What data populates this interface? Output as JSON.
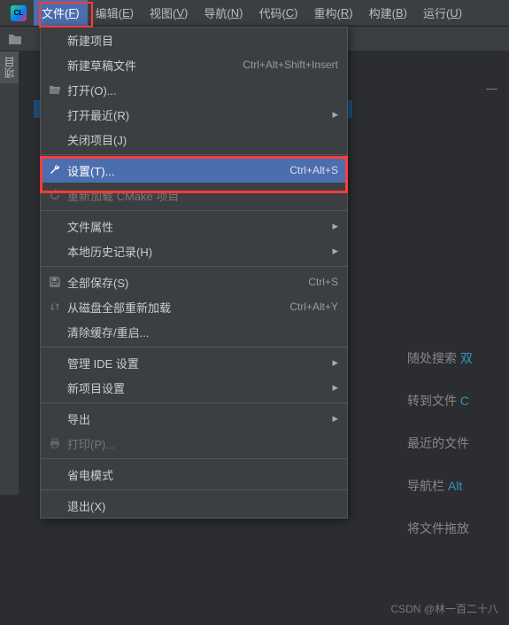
{
  "menubar": {
    "items": [
      {
        "label": "文件",
        "mnemonic": "F"
      },
      {
        "label": "编辑",
        "mnemonic": "E"
      },
      {
        "label": "视图",
        "mnemonic": "V"
      },
      {
        "label": "导航",
        "mnemonic": "N"
      },
      {
        "label": "代码",
        "mnemonic": "C"
      },
      {
        "label": "重构",
        "mnemonic": "R"
      },
      {
        "label": "构建",
        "mnemonic": "B"
      },
      {
        "label": "运行",
        "mnemonic": "U"
      }
    ],
    "active_index": 0,
    "logo_text": "CL"
  },
  "side_tab_label": "项目",
  "dropdown": {
    "items": [
      {
        "type": "item",
        "icon": "",
        "label": "新建项目",
        "shortcut": "",
        "submenu": false
      },
      {
        "type": "item",
        "icon": "",
        "label": "新建草稿文件",
        "shortcut": "Ctrl+Alt+Shift+Insert",
        "submenu": false
      },
      {
        "type": "item",
        "icon": "folder-open",
        "label": "打开(O)...",
        "shortcut": "",
        "submenu": false
      },
      {
        "type": "item",
        "icon": "",
        "label": "打开最近(R)",
        "shortcut": "",
        "submenu": true
      },
      {
        "type": "item",
        "icon": "",
        "label": "关闭项目(J)",
        "shortcut": "",
        "submenu": false
      },
      {
        "type": "sep"
      },
      {
        "type": "item",
        "icon": "wrench",
        "label": "设置(T)...",
        "shortcut": "Ctrl+Alt+S",
        "submenu": false,
        "selected": true
      },
      {
        "type": "item",
        "icon": "refresh",
        "label": "重新加载 CMake 项目",
        "shortcut": "",
        "submenu": false,
        "disabled": true
      },
      {
        "type": "sep"
      },
      {
        "type": "item",
        "icon": "",
        "label": "文件属性",
        "shortcut": "",
        "submenu": true
      },
      {
        "type": "item",
        "icon": "",
        "label": "本地历史记录(H)",
        "shortcut": "",
        "submenu": true
      },
      {
        "type": "sep"
      },
      {
        "type": "item",
        "icon": "save",
        "label": "全部保存(S)",
        "shortcut": "Ctrl+S",
        "submenu": false
      },
      {
        "type": "item",
        "icon": "reload",
        "label": "从磁盘全部重新加载",
        "shortcut": "Ctrl+Alt+Y",
        "submenu": false
      },
      {
        "type": "item",
        "icon": "",
        "label": "清除缓存/重启...",
        "shortcut": "",
        "submenu": false
      },
      {
        "type": "sep"
      },
      {
        "type": "item",
        "icon": "",
        "label": "管理 IDE 设置",
        "shortcut": "",
        "submenu": true
      },
      {
        "type": "item",
        "icon": "",
        "label": "新项目设置",
        "shortcut": "",
        "submenu": true
      },
      {
        "type": "sep"
      },
      {
        "type": "item",
        "icon": "",
        "label": "导出",
        "shortcut": "",
        "submenu": true
      },
      {
        "type": "item",
        "icon": "print",
        "label": "打印(P)...",
        "shortcut": "",
        "submenu": false,
        "disabled": true
      },
      {
        "type": "sep"
      },
      {
        "type": "item",
        "icon": "",
        "label": "省电模式",
        "shortcut": "",
        "submenu": false
      },
      {
        "type": "sep"
      },
      {
        "type": "item",
        "icon": "",
        "label": "退出(X)",
        "shortcut": "",
        "submenu": false
      }
    ]
  },
  "welcome": {
    "rows": [
      {
        "text": "随处搜索 ",
        "link": "双"
      },
      {
        "text": "转到文件 ",
        "link": "C"
      },
      {
        "text": "最近的文件",
        "link": ""
      },
      {
        "text": "导航栏 ",
        "link": "Alt"
      },
      {
        "text": "将文件拖放",
        "link": ""
      }
    ]
  },
  "watermark": "CSDN @林一百二十八"
}
